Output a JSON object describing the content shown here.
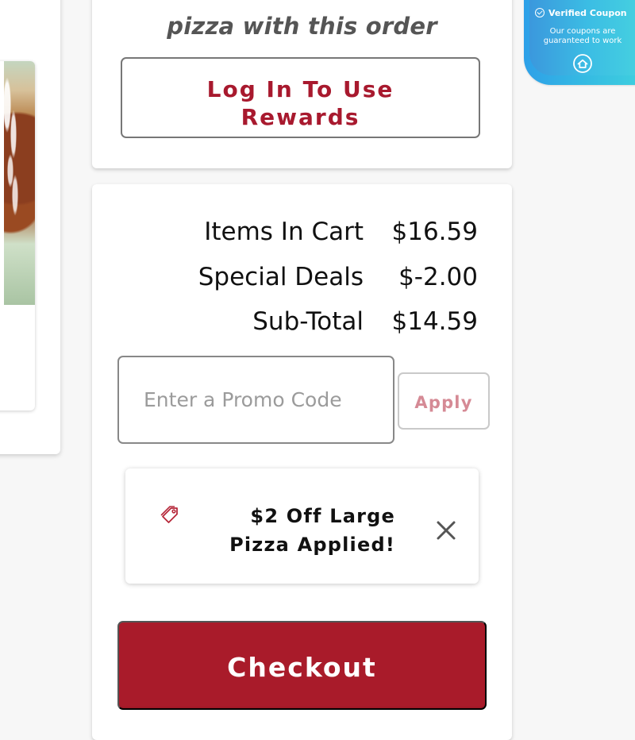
{
  "rewards": {
    "heading": "pizza with this order",
    "login_button": "Log In To Use\nRewards"
  },
  "summary": {
    "items_in_cart_label": "Items In Cart",
    "items_in_cart_value": "$16.59",
    "special_deals_label": "Special Deals",
    "special_deals_value": "$-2.00",
    "subtotal_label": "Sub-Total",
    "subtotal_value": "$14.59"
  },
  "promo": {
    "placeholder": "Enter a Promo Code",
    "apply_label": "Apply",
    "applied_message": "$2 Off Large\nPizza Applied!"
  },
  "checkout": {
    "label": "Checkout"
  },
  "coupon_badge": {
    "title": "Verified Coupon",
    "subtext": "Our coupons are\nguaranteed to work"
  },
  "icons": {
    "tag": "tag-icon",
    "close": "close-icon",
    "verified": "check-circle-icon",
    "home": "home-icon"
  },
  "colors": {
    "brand_red": "#a91b2a",
    "apply_disabled": "#d58a95",
    "coupon_blue": "#2ea0e8",
    "coupon_cyan": "#47d3df"
  }
}
